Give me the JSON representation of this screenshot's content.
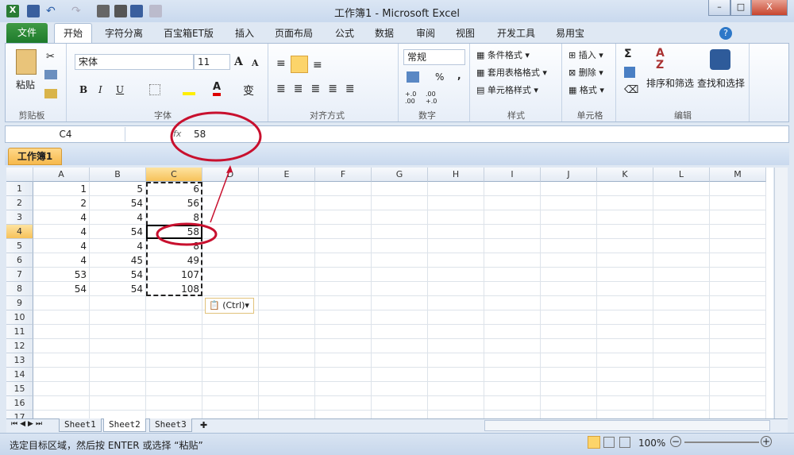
{
  "app": {
    "title": "工作簿1 - Microsoft Excel"
  },
  "window_controls": {
    "minimize": "–",
    "maximize": "□",
    "close": "X"
  },
  "tabs": [
    "文件",
    "开始",
    "字符分离",
    "百宝箱ET版",
    "插入",
    "页面布局",
    "公式",
    "数据",
    "审阅",
    "视图",
    "开发工具",
    "易用宝"
  ],
  "ribbon": {
    "clipboard": {
      "paste": "粘贴",
      "label": "剪贴板"
    },
    "font": {
      "name": "宋体",
      "size": "11",
      "bold": "B",
      "italic": "I",
      "underline": "U",
      "label": "字体",
      "grow": "A",
      "shrink": "A",
      "phonetic": "变"
    },
    "alignment": {
      "label": "对齐方式"
    },
    "number": {
      "format": "常规",
      "percent": "%",
      "comma": ",",
      "inc": "+.0 .00",
      "dec": ".00 +.0",
      "label": "数字"
    },
    "styles": {
      "conditional": "条件格式",
      "table": "套用表格格式",
      "cell": "单元格样式",
      "label": "样式"
    },
    "cells": {
      "insert": "插入",
      "delete": "删除",
      "format": "格式",
      "label": "单元格"
    },
    "editing": {
      "sum": "Σ",
      "sort": "排序和筛选",
      "find": "查找和选择",
      "label": "编辑"
    }
  },
  "formula_bar": {
    "name_box": "C4",
    "fx": "fx",
    "value": "58"
  },
  "workbook_tab": "工作簿1",
  "columns": [
    "A",
    "B",
    "C",
    "D",
    "E",
    "F",
    "G",
    "H",
    "I",
    "J",
    "K",
    "L",
    "M"
  ],
  "rows": [
    "1",
    "2",
    "3",
    "4",
    "5",
    "6",
    "7",
    "8",
    "9",
    "10",
    "11",
    "12",
    "13",
    "14",
    "15",
    "16",
    "17"
  ],
  "cells": [
    [
      "1",
      "5",
      "6"
    ],
    [
      "2",
      "54",
      "56"
    ],
    [
      "4",
      "4",
      "8"
    ],
    [
      "4",
      "54",
      "58"
    ],
    [
      "4",
      "4",
      "8"
    ],
    [
      "4",
      "45",
      "49"
    ],
    [
      "53",
      "54",
      "107"
    ],
    [
      "54",
      "54",
      "108"
    ]
  ],
  "paste_options": "(Ctrl)",
  "sheets": [
    "Sheet1",
    "Sheet2",
    "Sheet3"
  ],
  "active_sheet": "Sheet2",
  "status": {
    "message": "选定目标区域，然后按 ENTER 或选择 “粘贴”",
    "zoom": "100%"
  },
  "annotation_color": "#c8102e"
}
